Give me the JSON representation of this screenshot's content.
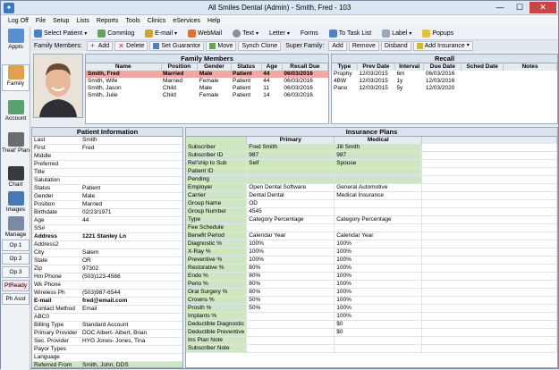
{
  "window": {
    "title": "All Smiles Dental (Admin) - Smith, Fred - 103",
    "min": "—",
    "max": "☐",
    "close": "✕"
  },
  "menu": [
    "Log Off",
    "File",
    "Setup",
    "Lists",
    "Reports",
    "Tools",
    "Clinics",
    "eServices",
    "Help"
  ],
  "toolbar": {
    "select_patient": "Select Patient",
    "commlog": "Commlog",
    "email": "E-mail",
    "webmail": "WebMail",
    "text": "Text",
    "letter": "Letter",
    "forms": "Forms",
    "to_task_list": "To Task List",
    "label": "Label",
    "popups": "Popups"
  },
  "family_bar": {
    "label": "Family Members:",
    "add": "Add",
    "delete": "Delete",
    "set_guarantor": "Set Guarantor",
    "move": "Move",
    "synch_clone": "Synch Clone",
    "super_family": "Super Family:",
    "sf_add": "Add",
    "remove": "Remove",
    "disband": "Disband",
    "add_insurance": "Add Insurance"
  },
  "nav": [
    {
      "label": "Appts",
      "icon": "calendar-icon"
    },
    {
      "label": "Family",
      "icon": "family-icon"
    },
    {
      "label": "Account",
      "icon": "account-icon"
    },
    {
      "label": "Treat' Plan",
      "icon": "treatplan-icon"
    },
    {
      "label": "Chart",
      "icon": "chart-icon"
    },
    {
      "label": "Images",
      "icon": "images-icon"
    },
    {
      "label": "Manage",
      "icon": "manage-icon"
    }
  ],
  "nav_buttons": [
    "Op 1",
    "Op 2",
    "Op 3",
    "PtReady",
    "Ph Asst"
  ],
  "family": {
    "title": "Family Members",
    "columns": [
      "Name",
      "Position",
      "Gender",
      "Status",
      "Age",
      "Recall Due"
    ],
    "rows": [
      [
        "Smith, Fred",
        "Married",
        "Male",
        "Patient",
        "44",
        "06/03/2016"
      ],
      [
        "Smith, Wife",
        "Married",
        "Female",
        "Patient",
        "44",
        "06/03/2016"
      ],
      [
        "Smith, Jason",
        "Child",
        "Male",
        "Patient",
        "11",
        "06/03/2016"
      ],
      [
        "Smith, Julie",
        "Child",
        "Female",
        "Patient",
        "14",
        "06/03/2016"
      ]
    ]
  },
  "recall": {
    "title": "Recall",
    "columns": [
      "Type",
      "Prev Date",
      "Interval",
      "Due Date",
      "Sched Date",
      "Notes"
    ],
    "rows": [
      [
        "Prophy",
        "12/03/2015",
        "6m",
        "06/03/2016",
        "",
        ""
      ],
      [
        "4BW",
        "12/03/2015",
        "1y",
        "12/03/2016",
        "",
        ""
      ],
      [
        "Pano",
        "12/03/2015",
        "5y",
        "12/03/2020",
        "",
        ""
      ]
    ]
  },
  "patient_info": {
    "title": "Patient Information",
    "rows": [
      [
        "Last",
        "Smith"
      ],
      [
        "First",
        "Fred"
      ],
      [
        "Middle",
        ""
      ],
      [
        "Preferred",
        ""
      ],
      [
        "Title",
        ""
      ],
      [
        "Salutation",
        ""
      ],
      [
        "Status",
        "Patient"
      ],
      [
        "Gender",
        "Male"
      ],
      [
        "Position",
        "Married"
      ],
      [
        "Birthdate",
        "02/23/1971"
      ],
      [
        "Age",
        "44"
      ],
      [
        "SS#",
        ""
      ],
      [
        "Address",
        "1221 Stanley Ln"
      ],
      [
        "Address2",
        ""
      ],
      [
        "City",
        "Salem"
      ],
      [
        "State",
        "OR"
      ],
      [
        "Zip",
        "97302"
      ],
      [
        "Hm Phone",
        "(503)123-4566"
      ],
      [
        "Wk Phone",
        ""
      ],
      [
        "Wireless Ph",
        "(503)987-6544"
      ],
      [
        "E-mail",
        "fred@email.com"
      ],
      [
        "Contact Method",
        "Email"
      ],
      [
        "ABC0",
        ""
      ],
      [
        "Billing Type",
        "Standard Account"
      ],
      [
        "Primary Provider",
        "DOC Albert- Albert, Brian"
      ],
      [
        "Sec. Provider",
        "HYG Jones- Jones, Tina"
      ],
      [
        "Payor Types",
        ""
      ],
      [
        "Language",
        ""
      ],
      [
        "Referred From",
        "Smith, John, DDS"
      ],
      [
        "Addr/Ph Note",
        ""
      ]
    ]
  },
  "insurance": {
    "title": "Insurance Plans",
    "col_primary": "Primary",
    "col_medical": "Medical",
    "rows": [
      [
        "Subscriber",
        "Fred Smith",
        "Jill Smith"
      ],
      [
        "Subscriber ID",
        "987",
        "987"
      ],
      [
        "Rel'ship to Sub",
        "Self",
        "Spouse"
      ],
      [
        "Patient ID",
        "",
        ""
      ],
      [
        "Pending",
        "",
        ""
      ],
      [
        "Employer",
        "Open Dental Software",
        "General Automotive"
      ],
      [
        "Carrier",
        "Dental Dental",
        "Medical Insurance"
      ],
      [
        "Group Name",
        "OD",
        ""
      ],
      [
        "Group Number",
        "4545",
        ""
      ],
      [
        "Type",
        "Category Percentage",
        "Category Percentage"
      ],
      [
        "Fee Schedule",
        "",
        ""
      ],
      [
        "Benefit Period",
        "Calendar Year",
        "Calendar Year"
      ],
      [
        "Diagnostic %",
        "100%",
        "100%"
      ],
      [
        "X-Ray %",
        "100%",
        "100%"
      ],
      [
        "Preventive %",
        "100%",
        "100%"
      ],
      [
        "Restorative %",
        "80%",
        "100%"
      ],
      [
        "Endo %",
        "80%",
        "100%"
      ],
      [
        "Perio %",
        "80%",
        "100%"
      ],
      [
        "Oral Surgery %",
        "80%",
        "100%"
      ],
      [
        "Crowns %",
        "50%",
        "100%"
      ],
      [
        "Prosth %",
        "50%",
        "100%"
      ],
      [
        "Implants %",
        "",
        "100%"
      ],
      [
        "Deductible Diagnostic",
        "",
        "$0"
      ],
      [
        "Deductible Preventive",
        "",
        "$0"
      ],
      [
        "Ins Plan Note",
        "",
        ""
      ],
      [
        "Subscriber Note",
        "",
        ""
      ]
    ]
  },
  "colors": {
    "selected_row": "#f0a9a0",
    "green": "#cfe6c3",
    "header": "#dbe4ee"
  }
}
